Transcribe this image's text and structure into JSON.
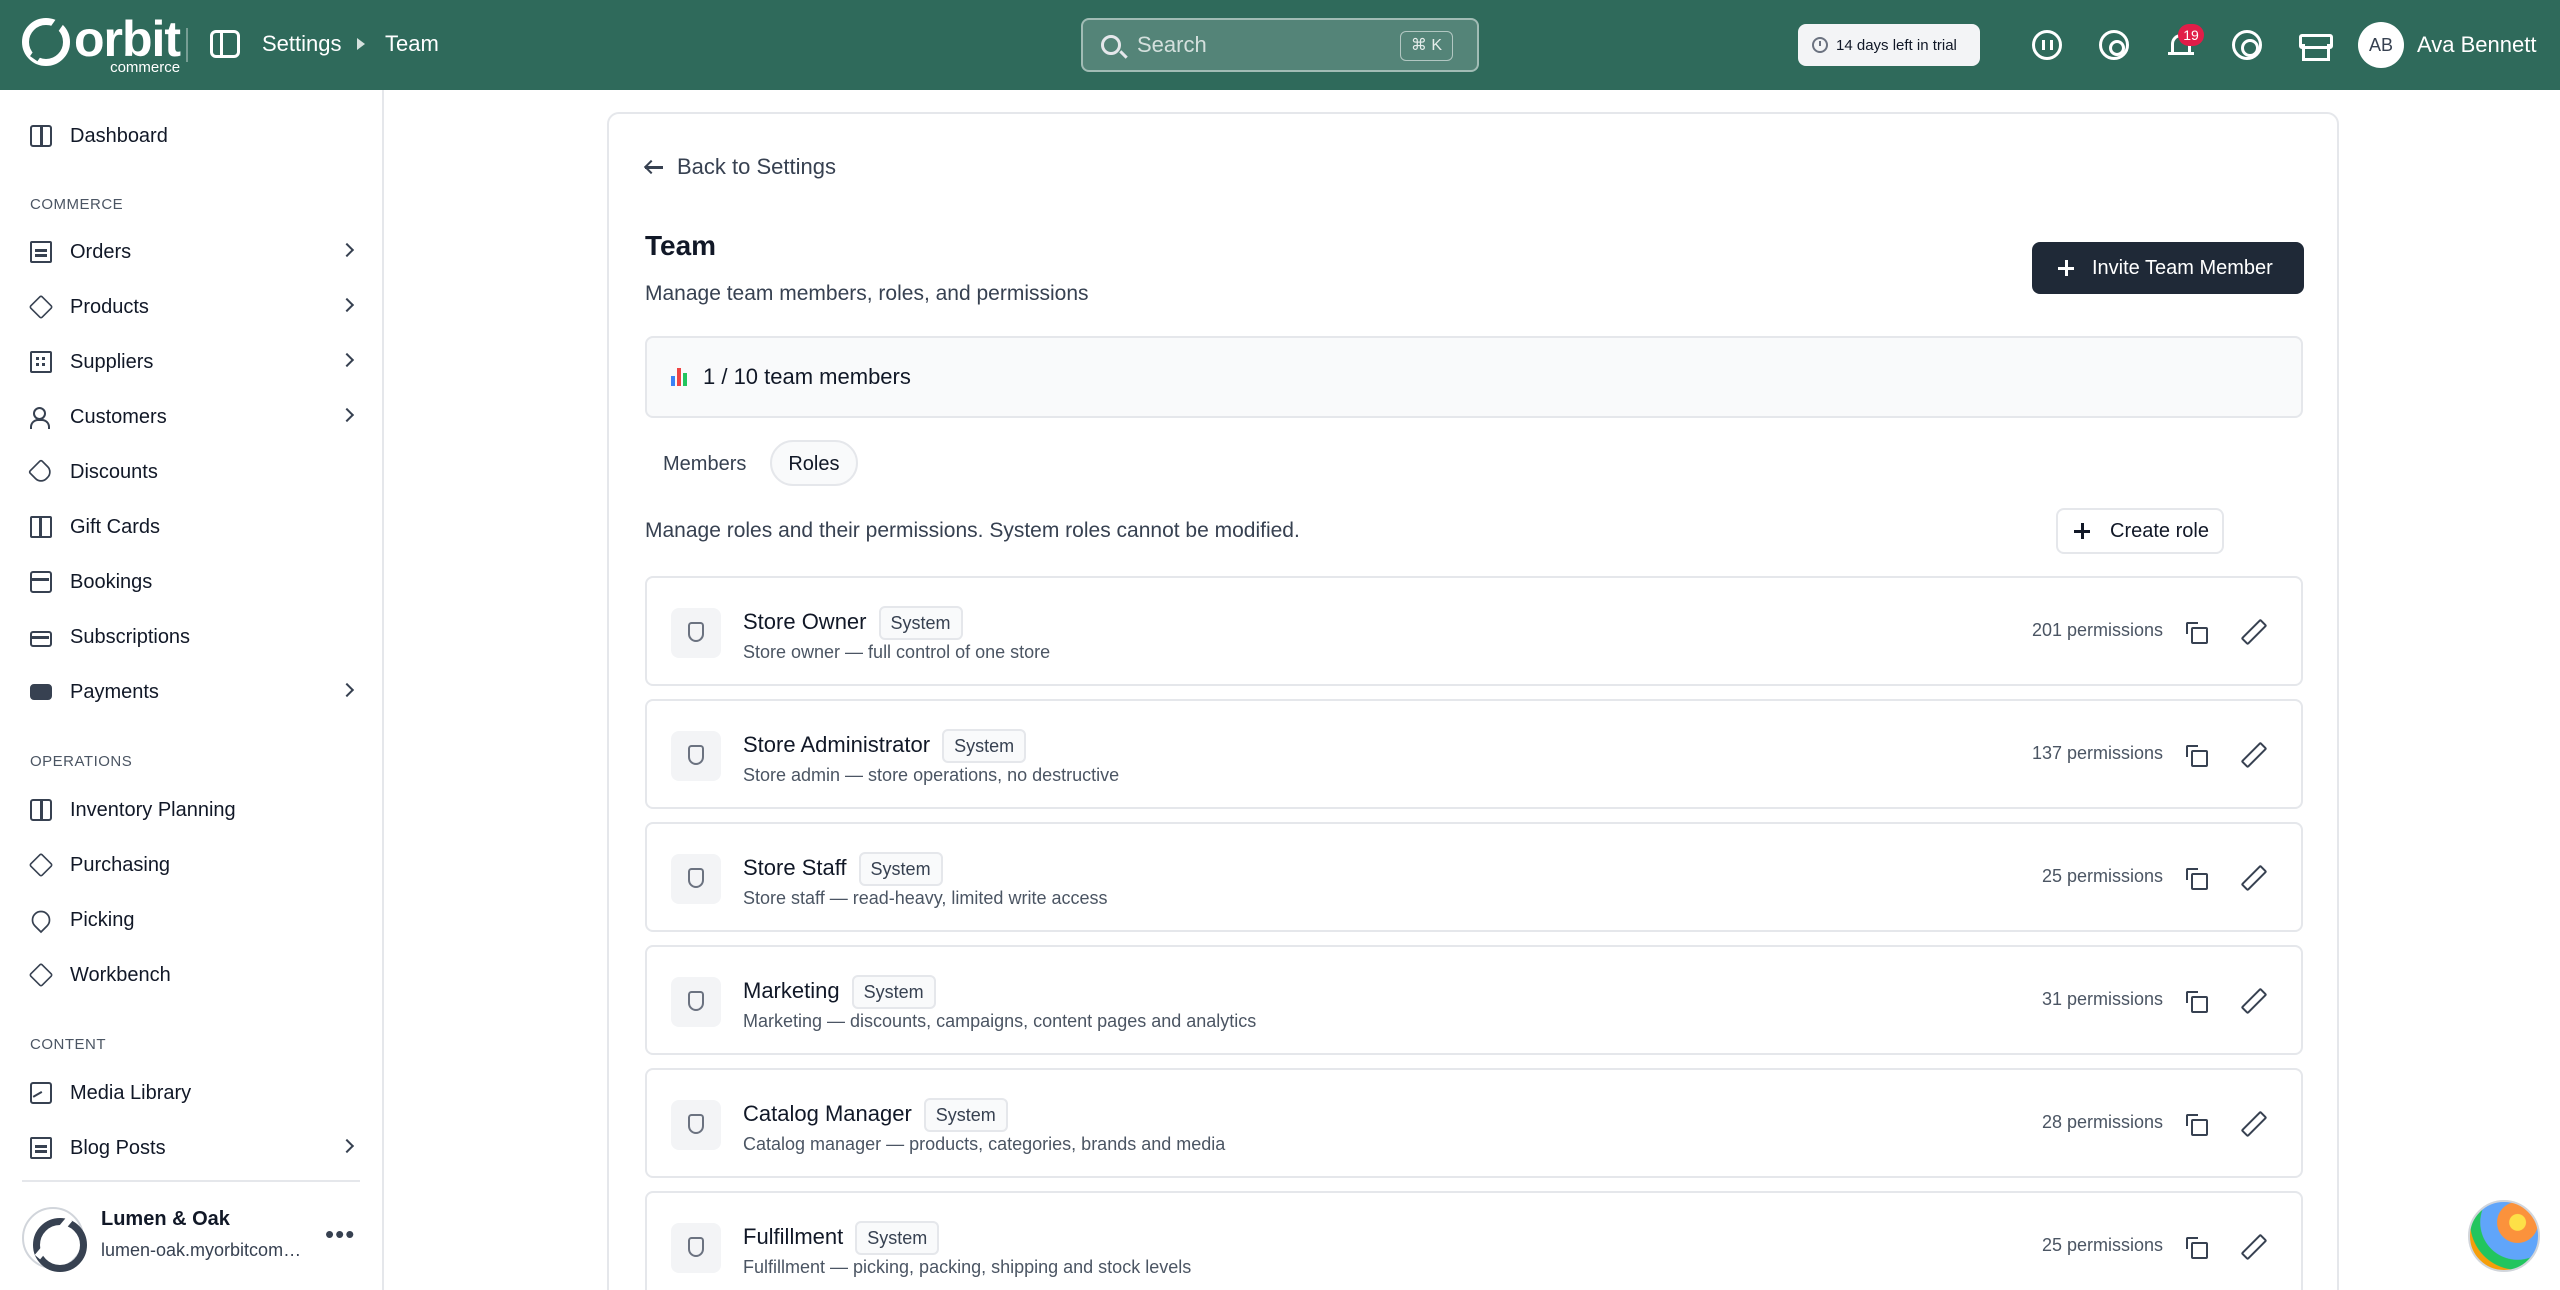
{
  "brand": {
    "name": "orbit",
    "sub": "commerce"
  },
  "breadcrumb": [
    "Settings",
    "Team"
  ],
  "search": {
    "placeholder": "Search",
    "shortcut": "⌘ K"
  },
  "trial": {
    "label": "14 days left in trial"
  },
  "notifications": {
    "count": "19"
  },
  "user": {
    "initials": "AB",
    "name": "Ava Bennett"
  },
  "sidebar": {
    "top": [
      {
        "label": "Dashboard",
        "icon": "dashboard-icon"
      }
    ],
    "sections": [
      {
        "title": "COMMERCE",
        "items": [
          {
            "label": "Orders",
            "icon": "orders-icon",
            "chevron": true
          },
          {
            "label": "Products",
            "icon": "products-icon",
            "chevron": true
          },
          {
            "label": "Suppliers",
            "icon": "suppliers-icon",
            "chevron": true
          },
          {
            "label": "Customers",
            "icon": "customers-icon",
            "chevron": true
          },
          {
            "label": "Discounts",
            "icon": "discount-tag-icon",
            "chevron": false
          },
          {
            "label": "Gift Cards",
            "icon": "gift-icon",
            "chevron": false
          },
          {
            "label": "Bookings",
            "icon": "calendar-icon",
            "chevron": false
          },
          {
            "label": "Subscriptions",
            "icon": "subscriptions-icon",
            "chevron": false
          },
          {
            "label": "Payments",
            "icon": "wallet-icon",
            "chevron": true
          }
        ]
      },
      {
        "title": "OPERATIONS",
        "items": [
          {
            "label": "Inventory Planning",
            "icon": "inventory-icon",
            "chevron": false
          },
          {
            "label": "Purchasing",
            "icon": "purchasing-icon",
            "chevron": false
          },
          {
            "label": "Picking",
            "icon": "pin-icon",
            "chevron": false
          },
          {
            "label": "Workbench",
            "icon": "workbench-icon",
            "chevron": false
          }
        ]
      },
      {
        "title": "CONTENT",
        "items": [
          {
            "label": "Media Library",
            "icon": "image-icon",
            "chevron": false
          },
          {
            "label": "Blog Posts",
            "icon": "blog-icon",
            "chevron": true
          }
        ]
      }
    ],
    "store": {
      "name": "Lumen & Oak",
      "url": "lumen-oak.myorbitcommerce.com"
    }
  },
  "page": {
    "back_label": "Back to Settings",
    "title": "Team",
    "subtitle": "Manage team members, roles, and permissions",
    "invite_label": "Invite Team Member",
    "usage": "1 / 10 team members",
    "tabs": [
      {
        "label": "Members",
        "active": false
      },
      {
        "label": "Roles",
        "active": true
      }
    ],
    "roles_description": "Manage roles and their permissions. System roles cannot be modified.",
    "create_role_label": "Create role",
    "roles": [
      {
        "name": "Store Owner",
        "badge": "System",
        "description": "Store owner — full control of one store",
        "permissions": "201 permissions"
      },
      {
        "name": "Store Administrator",
        "badge": "System",
        "description": "Store admin — store operations, no destructive",
        "permissions": "137 permissions"
      },
      {
        "name": "Store Staff",
        "badge": "System",
        "description": "Store staff — read-heavy, limited write access",
        "permissions": "25 permissions"
      },
      {
        "name": "Marketing",
        "badge": "System",
        "description": "Marketing — discounts, campaigns, content pages and analytics",
        "permissions": "31 permissions"
      },
      {
        "name": "Catalog Manager",
        "badge": "System",
        "description": "Catalog manager — products, categories, brands and media",
        "permissions": "28 permissions"
      },
      {
        "name": "Fulfillment",
        "badge": "System",
        "description": "Fulfillment — picking, packing, shipping and stock levels",
        "permissions": "25 permissions"
      }
    ]
  },
  "colors": {
    "topbar": "#2f6a5b",
    "primary_button": "#1f2937",
    "badge": "#e11d48"
  }
}
